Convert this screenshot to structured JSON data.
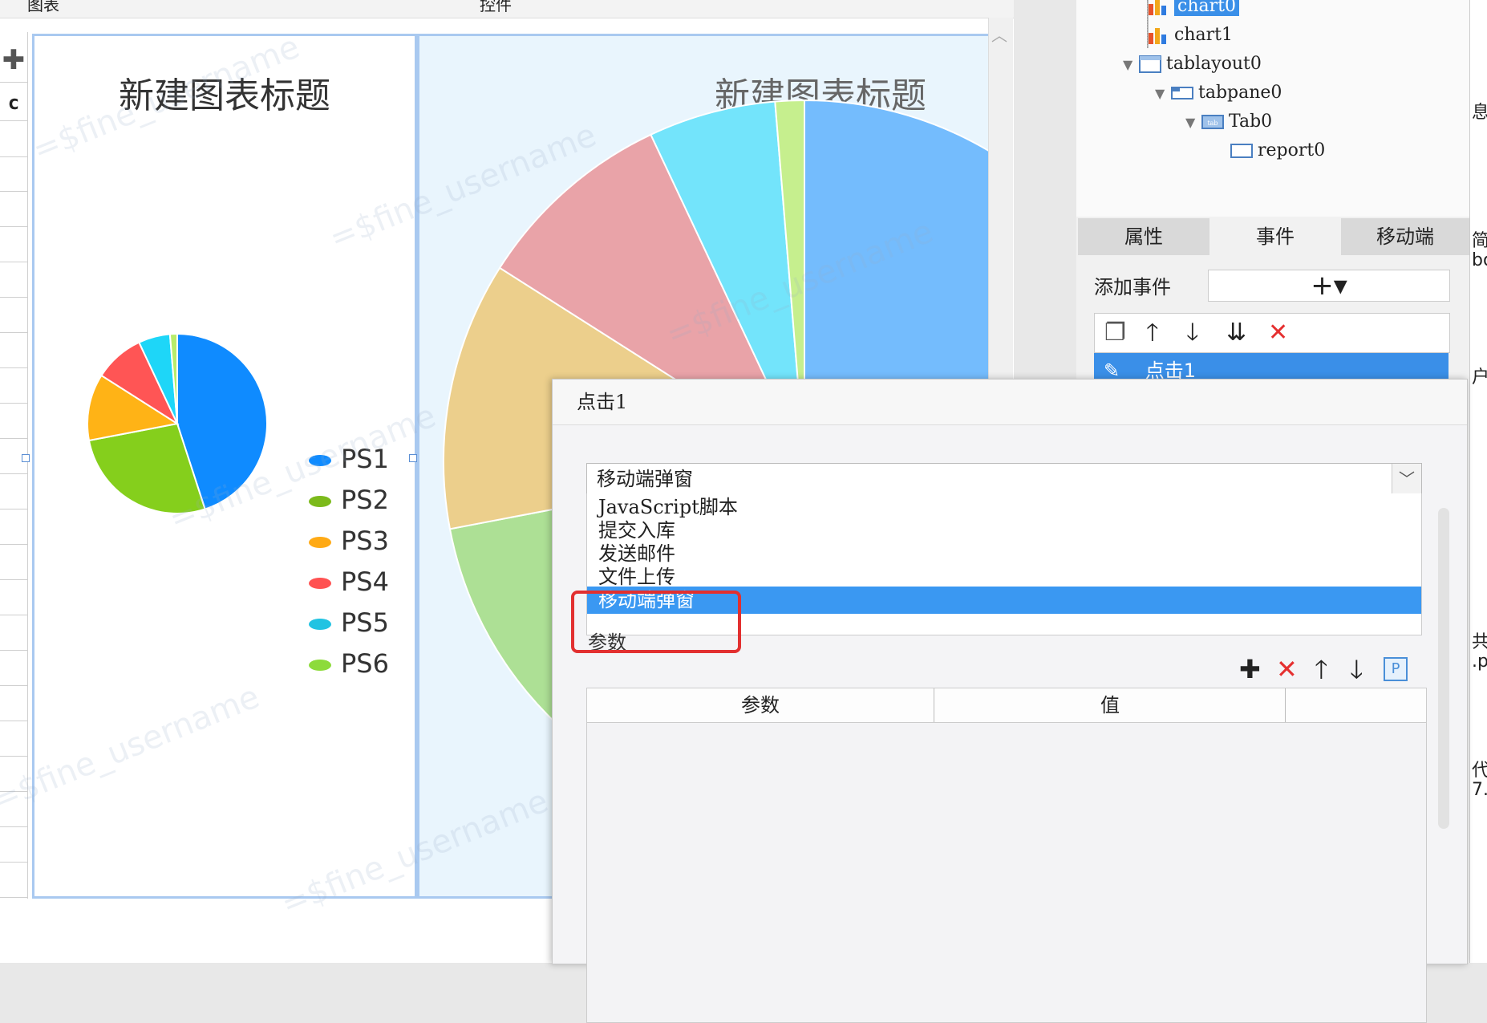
{
  "top_tabs": [
    "图表",
    "控件"
  ],
  "charts": [
    {
      "title": "新建图表标题",
      "legend": [
        {
          "name": "PS1",
          "color": "#0f8bff"
        },
        {
          "name": "PS2",
          "color": "#7cba1b"
        },
        {
          "name": "PS3",
          "color": "#ffaa15"
        },
        {
          "name": "PS4",
          "color": "#ff5252"
        },
        {
          "name": "PS5",
          "color": "#21c3e2"
        },
        {
          "name": "PS6",
          "color": "#8ddb3b"
        }
      ],
      "colors": [
        "#0f8bff",
        "#85cf1c",
        "#ffb316",
        "#ff5555",
        "#1ed6f8",
        "#b8ec6a"
      ]
    },
    {
      "title": "新建图表标题",
      "colors": [
        "#74bcfd",
        "#ade095",
        "#eccf8c",
        "#e9a3a8",
        "#73e4fb",
        "#c6ef8e"
      ]
    }
  ],
  "chart_data": [
    {
      "type": "pie",
      "title": "新建图表标题",
      "categories": [
        "PS1",
        "PS2",
        "PS3",
        "PS4",
        "PS5",
        "PS6"
      ],
      "values": [
        45,
        27,
        12,
        9,
        5.7,
        1.3
      ]
    },
    {
      "type": "pie",
      "title": "新建图表标题",
      "categories": [],
      "values": [
        45,
        27,
        12,
        9,
        5.7,
        1.3
      ]
    }
  ],
  "tree": {
    "items": [
      {
        "label": "chart0",
        "selected": true
      },
      {
        "label": "chart1"
      },
      {
        "label": "tablayout0"
      },
      {
        "label": "tabpane0"
      },
      {
        "label": "Tab0"
      },
      {
        "label": "report0"
      }
    ]
  },
  "prop_tabs": [
    "属性",
    "事件",
    "移动端"
  ],
  "events": {
    "add_label": "添加事件",
    "add_symbol": "+▾",
    "item": "点击1"
  },
  "dialog": {
    "title": "点击1",
    "select_value": "移动端弹窗",
    "options": [
      "JavaScript脚本",
      "提交入库",
      "发送邮件",
      "文件上传",
      "移动端弹窗"
    ],
    "selected_index": 4,
    "params_label": "参数",
    "table_headers": [
      "参数",
      "值"
    ]
  },
  "watermark": "=$fine_username",
  "edge_text": [
    "息",
    "简",
    "bo",
    "户",
    "共",
    ".p",
    "代",
    "7."
  ]
}
